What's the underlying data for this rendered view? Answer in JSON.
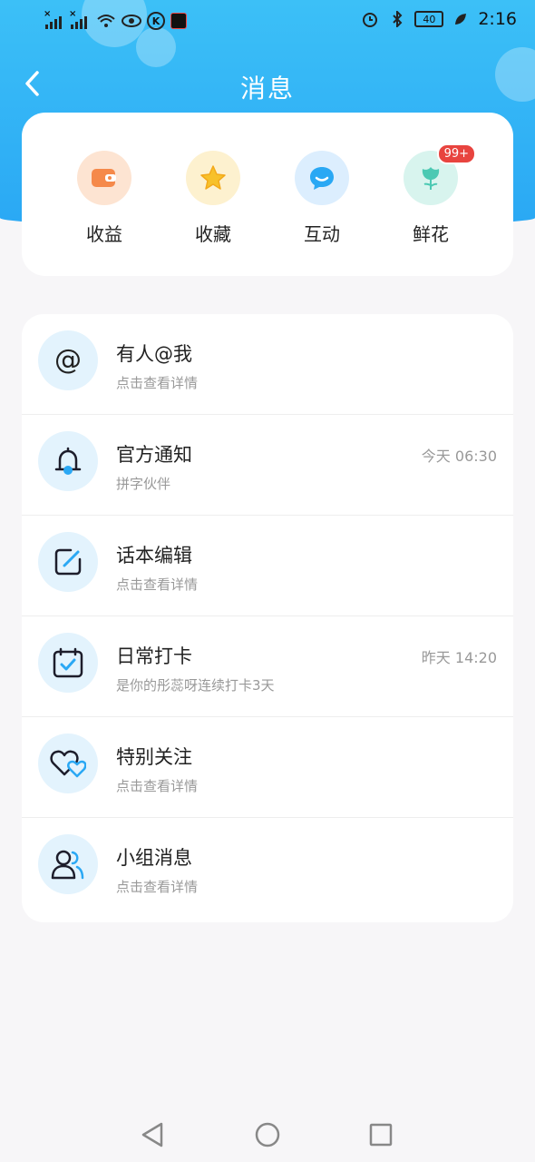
{
  "status_bar": {
    "time": "2:16",
    "battery": "40"
  },
  "header": {
    "title": "消息"
  },
  "categories": [
    {
      "label": "收益",
      "icon": "wallet-icon",
      "color": "#f5894a"
    },
    {
      "label": "收藏",
      "icon": "star-icon",
      "color": "#f7c12b"
    },
    {
      "label": "互动",
      "icon": "chat-bubble-icon",
      "color": "#2aa8f4"
    },
    {
      "label": "鲜花",
      "icon": "flower-icon",
      "color": "#4cc9b3",
      "badge": "99+"
    }
  ],
  "messages": [
    {
      "title": "有人@我",
      "subtitle": "点击查看详情",
      "time": "",
      "icon": "at-icon"
    },
    {
      "title": "官方通知",
      "subtitle": "拼字伙伴",
      "time": "今天 06:30",
      "icon": "bell-icon"
    },
    {
      "title": "话本编辑",
      "subtitle": "点击查看详情",
      "time": "",
      "icon": "edit-icon"
    },
    {
      "title": "日常打卡",
      "subtitle": "是你的彤蕊呀连续打卡3天",
      "time": "昨天 14:20",
      "icon": "calendar-check-icon"
    },
    {
      "title": "特别关注",
      "subtitle": "点击查看详情",
      "time": "",
      "icon": "hearts-icon"
    },
    {
      "title": "小组消息",
      "subtitle": "点击查看详情",
      "time": "",
      "icon": "group-icon"
    }
  ],
  "colors": {
    "header_blue": "#2aa8f4",
    "accent_blue": "#2aa8f4",
    "badge_red": "#e8443f"
  }
}
